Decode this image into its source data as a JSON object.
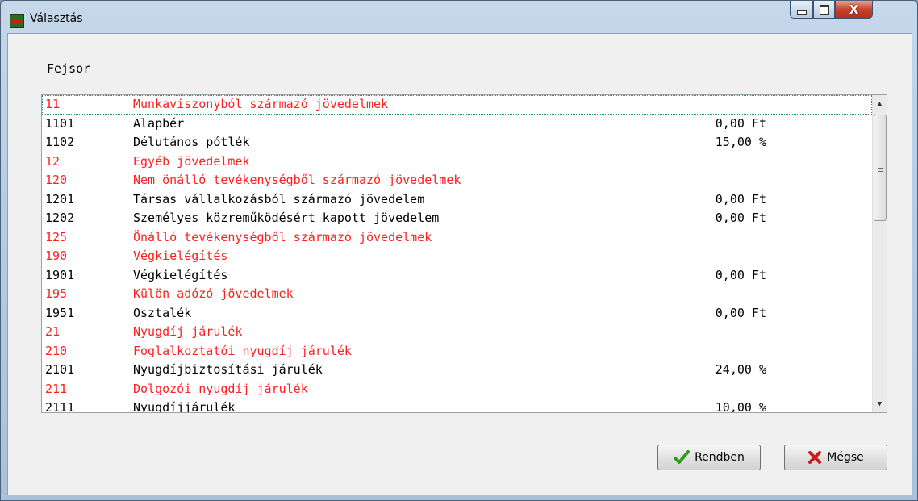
{
  "window": {
    "title": "Választás",
    "app_icon": "app-icon",
    "close_symbol": "X"
  },
  "dialog": {
    "header_label": "Fejsor"
  },
  "list": {
    "rows": [
      {
        "code": "11",
        "name": "Munkaviszonyból származó jövedelmek",
        "value": "",
        "type": "header"
      },
      {
        "code": "1101",
        "name": "Alapbér",
        "value": "0,00 Ft",
        "type": "item"
      },
      {
        "code": "1102",
        "name": "Délutános pótlék",
        "value": "15,00 %",
        "type": "item"
      },
      {
        "code": "12",
        "name": "Egyéb jövedelmek",
        "value": "",
        "type": "header"
      },
      {
        "code": "120",
        "name": "Nem önálló tevékenységből származó jövedelmek",
        "value": "",
        "type": "header"
      },
      {
        "code": "1201",
        "name": "Társas vállalkozásból származó jövedelem",
        "value": "0,00 Ft",
        "type": "item"
      },
      {
        "code": "1202",
        "name": "Személyes közreműködésért kapott jövedelem",
        "value": "0,00 Ft",
        "type": "item"
      },
      {
        "code": "125",
        "name": "Önálló tevékenységből származó jövedelmek",
        "value": "",
        "type": "header"
      },
      {
        "code": "190",
        "name": "Végkielégítés",
        "value": "",
        "type": "header"
      },
      {
        "code": "1901",
        "name": "Végkielégítés",
        "value": "0,00 Ft",
        "type": "item"
      },
      {
        "code": "195",
        "name": "Külön adózó jövedelmek",
        "value": "",
        "type": "header"
      },
      {
        "code": "1951",
        "name": "Osztalék",
        "value": "0,00 Ft",
        "type": "item"
      },
      {
        "code": "21",
        "name": "Nyugdíj járulék",
        "value": "",
        "type": "header"
      },
      {
        "code": "210",
        "name": "Foglalkoztatói nyugdíj járulék",
        "value": "",
        "type": "header"
      },
      {
        "code": "2101",
        "name": "Nyugdíjbiztosítási járulék",
        "value": "24,00 %",
        "type": "item"
      },
      {
        "code": "211",
        "name": "Dolgozói nyugdíj járulék",
        "value": "",
        "type": "header"
      },
      {
        "code": "2111",
        "name": "Nyugdíjjárulék",
        "value": "10,00 %",
        "type": "item"
      }
    ],
    "header_color": "#ff1f1f",
    "item_color": "#000000"
  },
  "buttons": {
    "ok_label": "Rendben",
    "cancel_label": "Mégse",
    "ok_icon": "check-icon",
    "cancel_icon": "cross-icon"
  }
}
